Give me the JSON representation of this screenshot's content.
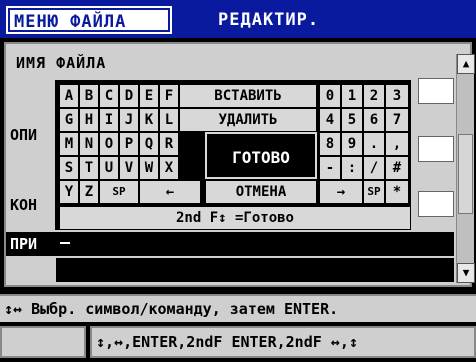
{
  "tabs": {
    "file": "МЕНЮ ФАЙЛА",
    "edit": "РЕДАКТИР."
  },
  "panel": {
    "filename_label": "ИМЯ ФАЙЛА",
    "side_labels": [
      "ОПИ",
      "КОН",
      "ПРИ"
    ]
  },
  "keyboard": {
    "row1": [
      "A",
      "B",
      "C",
      "D",
      "E",
      "F",
      "ВСТАВИТЬ",
      "0",
      "1",
      "2",
      "3"
    ],
    "row2": [
      "G",
      "H",
      "I",
      "J",
      "K",
      "L",
      "УДАЛИТЬ",
      "4",
      "5",
      "6",
      "7"
    ],
    "row3": [
      "M",
      "N",
      "O",
      "P",
      "Q",
      "R",
      "8",
      "9",
      ".",
      ","
    ],
    "row4": [
      "S",
      "T",
      "U",
      "V",
      "W",
      "X",
      "-",
      ":",
      "/",
      "#"
    ],
    "row5": [
      "Y",
      "Z",
      "SP",
      "←",
      "ОТМЕНА",
      "→",
      "SP",
      "*"
    ],
    "done": "ГОТОВО",
    "second_f": "2nd F↕ =Готово"
  },
  "status": {
    "line1": "↕↔ Выбр. символ/команду, затем ENTER.",
    "line2": "↕,↔,ENTER,2ndF ENTER,2ndF ↔,↕"
  },
  "icons": {
    "scroll_up": "triangle-up",
    "scroll_down": "triangle-down"
  },
  "colors": {
    "tab_bar": "#0a1a9e",
    "panel": "#cfcfcf",
    "key": "#d8d8d8"
  }
}
